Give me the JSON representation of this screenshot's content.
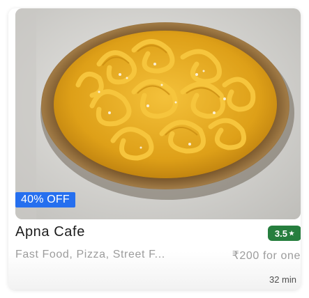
{
  "restaurant": {
    "image_alt": "bowl of jalebi",
    "offer": "40% OFF",
    "name": "Apna Cafe",
    "rating": "3.5",
    "rating_icon": "star-icon",
    "cuisines": "Fast Food, Pizza, Street F...",
    "price": "₹200 for one",
    "delivery_time": "32 min"
  },
  "colors": {
    "offer_badge": "#256fef",
    "rating_badge": "#267e3e",
    "jalebi": "#e7a51c"
  }
}
